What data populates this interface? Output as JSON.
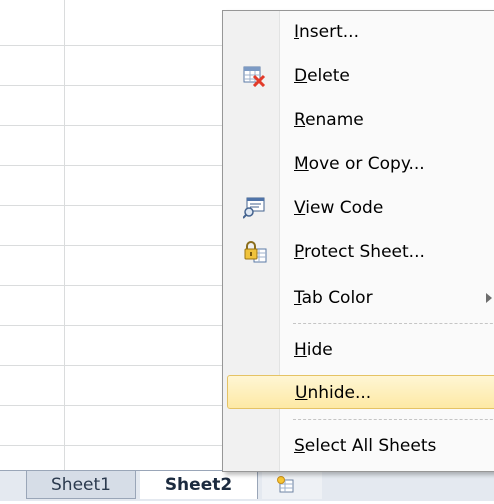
{
  "menu": {
    "items": [
      {
        "label": "Insert...",
        "key": "I"
      },
      {
        "label": "Delete",
        "key": "D"
      },
      {
        "label": "Rename",
        "key": "R"
      },
      {
        "label": "Move or Copy...",
        "key": "M"
      },
      {
        "label": "View Code",
        "key": "V"
      },
      {
        "label": "Protect Sheet...",
        "key": "P"
      },
      {
        "label": "Tab Color",
        "key": "T"
      },
      {
        "label": "Hide",
        "key": "H"
      },
      {
        "label": "Unhide...",
        "key": "U"
      },
      {
        "label": "Select All Sheets",
        "key": "S"
      }
    ],
    "highlighted_item": "Unhide..."
  },
  "tabs": [
    {
      "label": "Sheet1",
      "active": false
    },
    {
      "label": "Sheet2",
      "active": true
    }
  ],
  "icons": {
    "delete": "delete-sheet-icon",
    "view_code": "view-code-icon",
    "protect": "protect-sheet-icon",
    "new_sheet": "insert-worksheet-icon"
  },
  "colors": {
    "highlight": "#fde9a5",
    "delete_x": "#e23b2a"
  }
}
